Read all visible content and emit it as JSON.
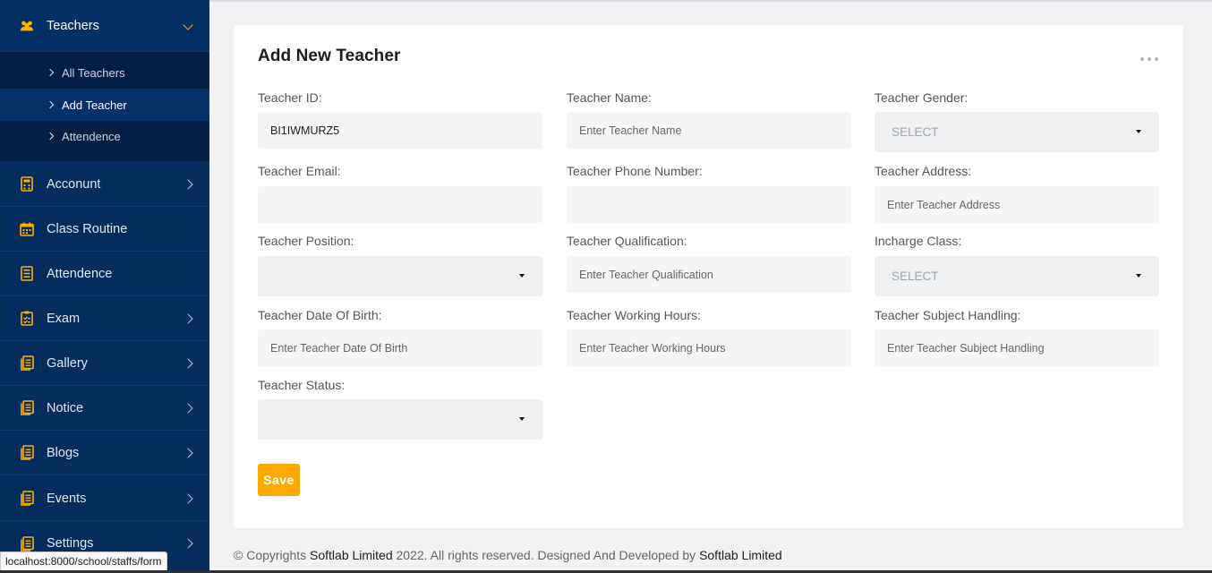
{
  "sidebar": {
    "teachers": {
      "label": "Teachers",
      "icon": "users-icon"
    },
    "submenu": [
      {
        "label": "All Teachers"
      },
      {
        "label": "Add Teacher"
      },
      {
        "label": "Attendence"
      }
    ],
    "items": [
      {
        "label": "Acconunt",
        "icon": "calculator-icon",
        "has_arrow": true
      },
      {
        "label": "Class Routine",
        "icon": "calendar-icon",
        "has_arrow": false
      },
      {
        "label": "Attendence",
        "icon": "checklist-icon",
        "has_arrow": false
      },
      {
        "label": "Exam",
        "icon": "clipboard-icon",
        "has_arrow": true
      },
      {
        "label": "Gallery",
        "icon": "document-icon",
        "has_arrow": true
      },
      {
        "label": "Notice",
        "icon": "document-icon",
        "has_arrow": true
      },
      {
        "label": "Blogs",
        "icon": "document-icon",
        "has_arrow": true
      },
      {
        "label": "Events",
        "icon": "document-icon",
        "has_arrow": true
      },
      {
        "label": "Settings",
        "icon": "document-icon",
        "has_arrow": true
      }
    ],
    "accent_color": "#ffb100",
    "bg_color": "#042c5c"
  },
  "form": {
    "title": "Add New Teacher",
    "fields": {
      "teacher_id": {
        "label": "Teacher ID:",
        "value": "BI1IWMURZ5"
      },
      "teacher_name": {
        "label": "Teacher Name:",
        "placeholder": "Enter Teacher Name"
      },
      "teacher_gender": {
        "label": "Teacher Gender:",
        "selected": "SELECT"
      },
      "teacher_email": {
        "label": "Teacher Email:",
        "placeholder": ""
      },
      "teacher_phone": {
        "label": "Teacher Phone Number:",
        "placeholder": ""
      },
      "teacher_address": {
        "label": "Teacher Address:",
        "placeholder": "Enter Teacher Address"
      },
      "teacher_position": {
        "label": "Teacher Position:",
        "selected": ""
      },
      "teacher_qualification": {
        "label": "Teacher Qualification:",
        "placeholder": "Enter Teacher Qualification"
      },
      "incharge_class": {
        "label": "Incharge Class:",
        "selected": "SELECT"
      },
      "teacher_dob": {
        "label": "Teacher Date Of Birth:",
        "placeholder": "Enter Teacher Date Of Birth"
      },
      "teacher_hours": {
        "label": "Teacher Working Hours:",
        "placeholder": "Enter Teacher Working Hours"
      },
      "teacher_subject": {
        "label": "Teacher Subject Handling:",
        "placeholder": "Enter Teacher Subject Handling"
      },
      "teacher_status": {
        "label": "Teacher Status:",
        "selected": ""
      }
    },
    "save_label": "Save",
    "button_color": "#ffa900"
  },
  "footer": {
    "prefix": "© Copyrights ",
    "brand1": "Softlab Limited",
    "middle": " 2022. All rights reserved. Designed And Developed by ",
    "brand2": "Softlab Limited"
  },
  "status_url": "localhost:8000/school/staffs/form"
}
